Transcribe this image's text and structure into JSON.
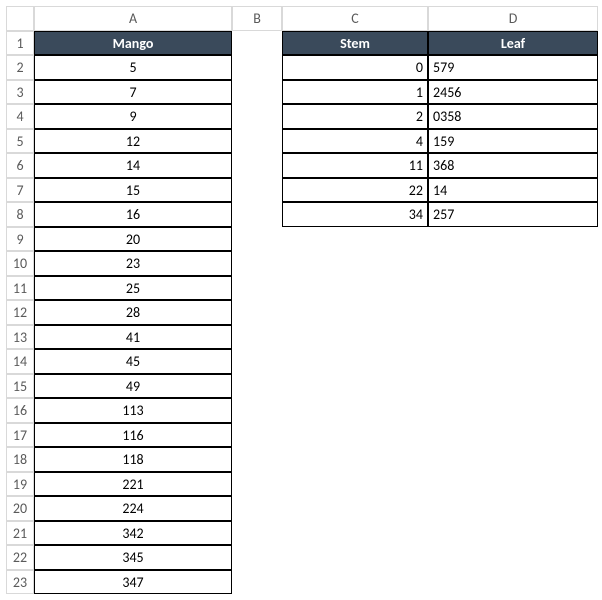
{
  "columns": [
    "A",
    "B",
    "C",
    "D"
  ],
  "rows": [
    "1",
    "2",
    "3",
    "4",
    "5",
    "6",
    "7",
    "8",
    "9",
    "10",
    "11",
    "12",
    "13",
    "14",
    "15",
    "16",
    "17",
    "18",
    "19",
    "20",
    "21",
    "22",
    "23"
  ],
  "headers": {
    "mango": "Mango",
    "stem": "Stem",
    "leaf": "Leaf"
  },
  "mango": [
    "5",
    "7",
    "9",
    "12",
    "14",
    "15",
    "16",
    "20",
    "23",
    "25",
    "28",
    "41",
    "45",
    "49",
    "113",
    "116",
    "118",
    "221",
    "224",
    "342",
    "345",
    "347"
  ],
  "stemleaf": [
    {
      "stem": "0",
      "leaf": "579"
    },
    {
      "stem": "1",
      "leaf": "2456"
    },
    {
      "stem": "2",
      "leaf": "0358"
    },
    {
      "stem": "4",
      "leaf": "159"
    },
    {
      "stem": "11",
      "leaf": "368"
    },
    {
      "stem": "22",
      "leaf": "14"
    },
    {
      "stem": "34",
      "leaf": "257"
    }
  ]
}
